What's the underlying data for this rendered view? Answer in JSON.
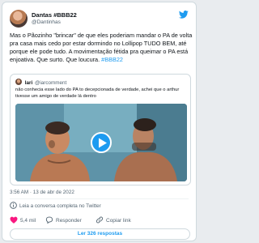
{
  "author": {
    "name": "Dantas #BBB22",
    "handle": "@Dantinhas"
  },
  "tweet": {
    "text_before": "Mas o Pãozinho \"brincar\" de que eles poderiam mandar o PA de volta pra casa mais cedo por estar dormindo no Lollipop TUDO BEM, até porque ele pode tudo. A movimentação fétida pra queimar o PA está enjoativa. Que surto. Que loucura. ",
    "hashtag": "#BBB22"
  },
  "quote": {
    "name": "Iari",
    "handle": "@iarcomment",
    "text": "não conhecia esse lado do PA to decepcionada de verdade, achei que o arthur tivesse um amigo de verdade lá dentro"
  },
  "timestamp": "3:56 AM · 13 de abr de 2022",
  "read_label": "Leia a conversa completa no Twitter",
  "actions": {
    "likes": "5,4 mil",
    "reply": "Responder",
    "copy": "Copiar link"
  },
  "replies_button": "Ler 326 respostas",
  "colors": {
    "accent": "#1d9bf0",
    "heart": "#f91880",
    "text": "#0f1419",
    "muted": "#536471"
  },
  "icons": [
    "twitter-bird-icon",
    "play-icon",
    "info-icon",
    "heart-icon",
    "reply-icon",
    "link-icon"
  ]
}
